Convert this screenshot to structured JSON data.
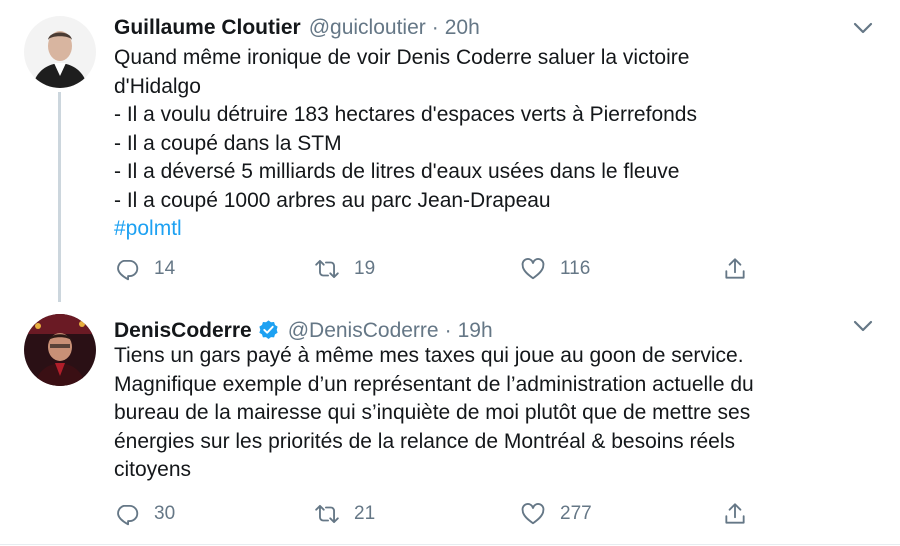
{
  "tweets": [
    {
      "name": "Guillaume Cloutier",
      "handle": "@guicloutier",
      "separator": "·",
      "time": "20h",
      "verified": false,
      "lines": [
        "Quand même ironique de voir Denis Coderre saluer la victoire",
        "d'Hidalgo",
        "- Il a voulu détruire 183 hectares d'espaces verts à Pierrefonds",
        "- Il a coupé dans la STM",
        "- Il a déversé 5 milliards de litres d'eaux usées dans le fleuve",
        "- Il a coupé 1000 arbres au parc Jean-Drapeau"
      ],
      "hashtag": "#polmtl",
      "replies": "14",
      "retweets": "19",
      "likes": "116"
    },
    {
      "name": "DenisCoderre",
      "handle": "@DenisCoderre",
      "separator": "·",
      "time": "19h",
      "verified": true,
      "lines": [
        "Tiens un gars payé à même mes taxes qui joue au goon de service.",
        "Magnifique exemple d’un représentant de l’administration actuelle du",
        "bureau de la mairesse qui s’inquiète de moi plutôt que de mettre ses",
        "énergies sur les priorités de la relance de Montréal & besoins réels",
        "citoyens"
      ],
      "replies": "30",
      "retweets": "21",
      "likes": "277"
    }
  ],
  "icons": {
    "reply": "reply-icon",
    "retweet": "retweet-icon",
    "like": "heart-icon",
    "share": "share-icon",
    "menu": "chevron-down-icon",
    "verified": "verified-badge-icon"
  },
  "colors": {
    "text": "#14171a",
    "secondary": "#657786",
    "accent": "#1da1f2",
    "thread_line": "#ccd6dd"
  }
}
